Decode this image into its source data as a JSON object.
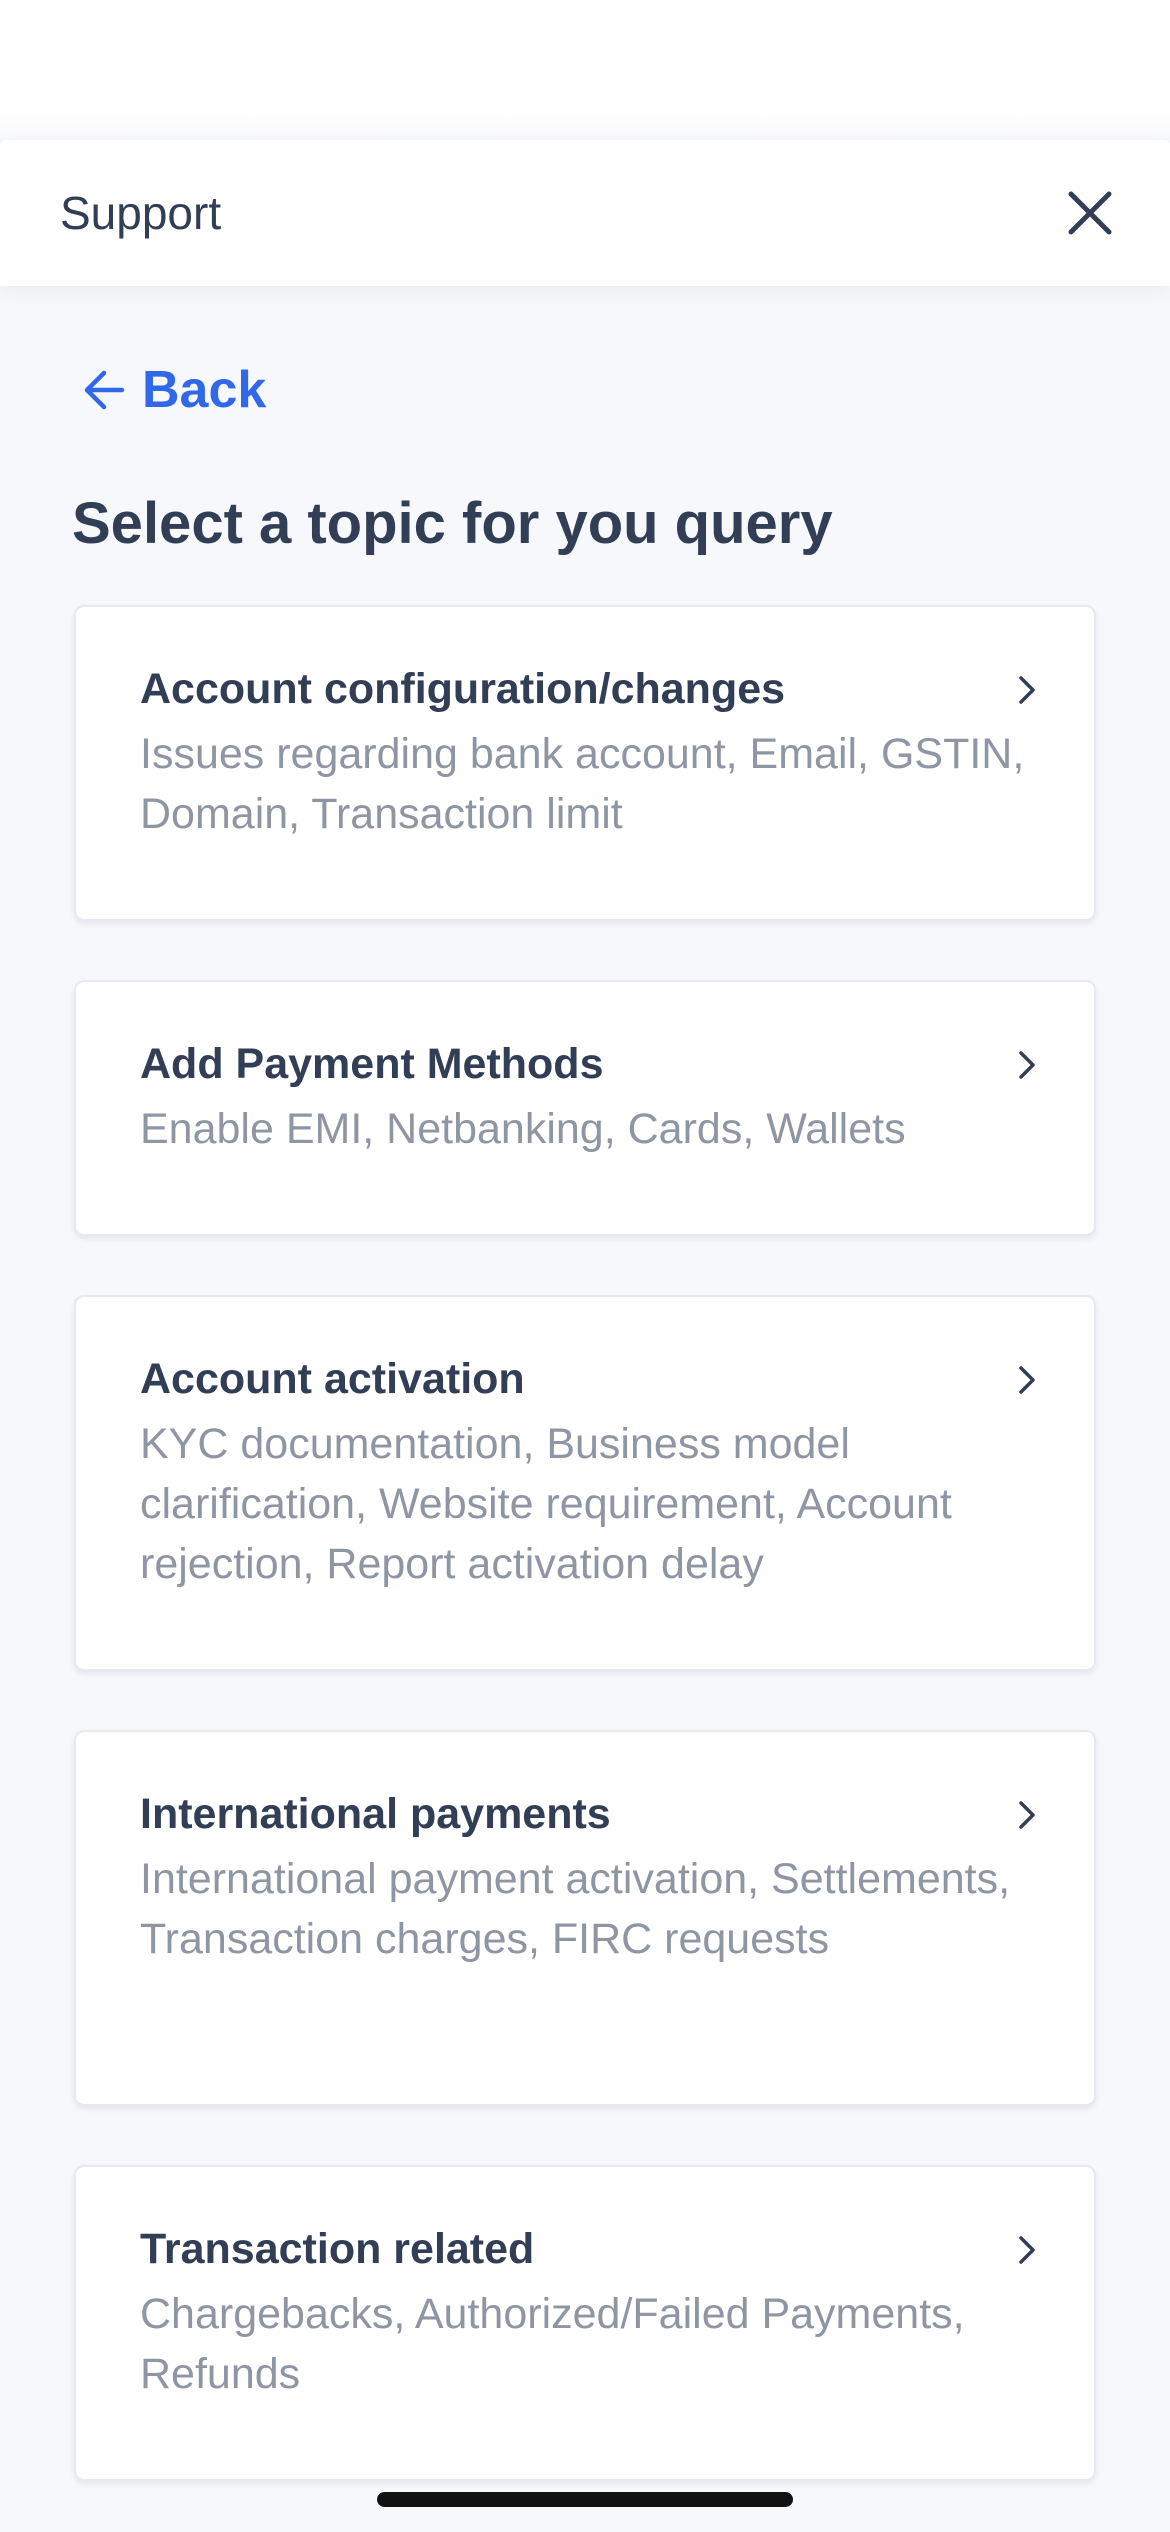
{
  "header": {
    "title": "Support",
    "close_icon": "close-icon"
  },
  "back": {
    "label": "Back",
    "icon": "arrow-left-icon"
  },
  "page_title": "Select a topic for you query",
  "topics": [
    {
      "title": "Account configuration/changes",
      "description": "Issues regarding bank account, Email, GSTIN, Domain, Transaction limit"
    },
    {
      "title": "Add Payment Methods",
      "description": "Enable EMI, Netbanking, Cards, Wallets"
    },
    {
      "title": "Account activation",
      "description": "KYC documentation, Business model clarification, Website requirement, Account rejection, Report activation delay"
    },
    {
      "title": "International payments",
      "description": "International payment activation, Settlements, Transaction charges, FIRC requests"
    },
    {
      "title": "Transaction related",
      "description": "Chargebacks, Authorized/Failed Payments, Refunds"
    }
  ],
  "colors": {
    "accent": "#3168e8",
    "text_primary": "#323e55",
    "text_secondary": "#8f96a3",
    "background": "#f7f8fb"
  }
}
